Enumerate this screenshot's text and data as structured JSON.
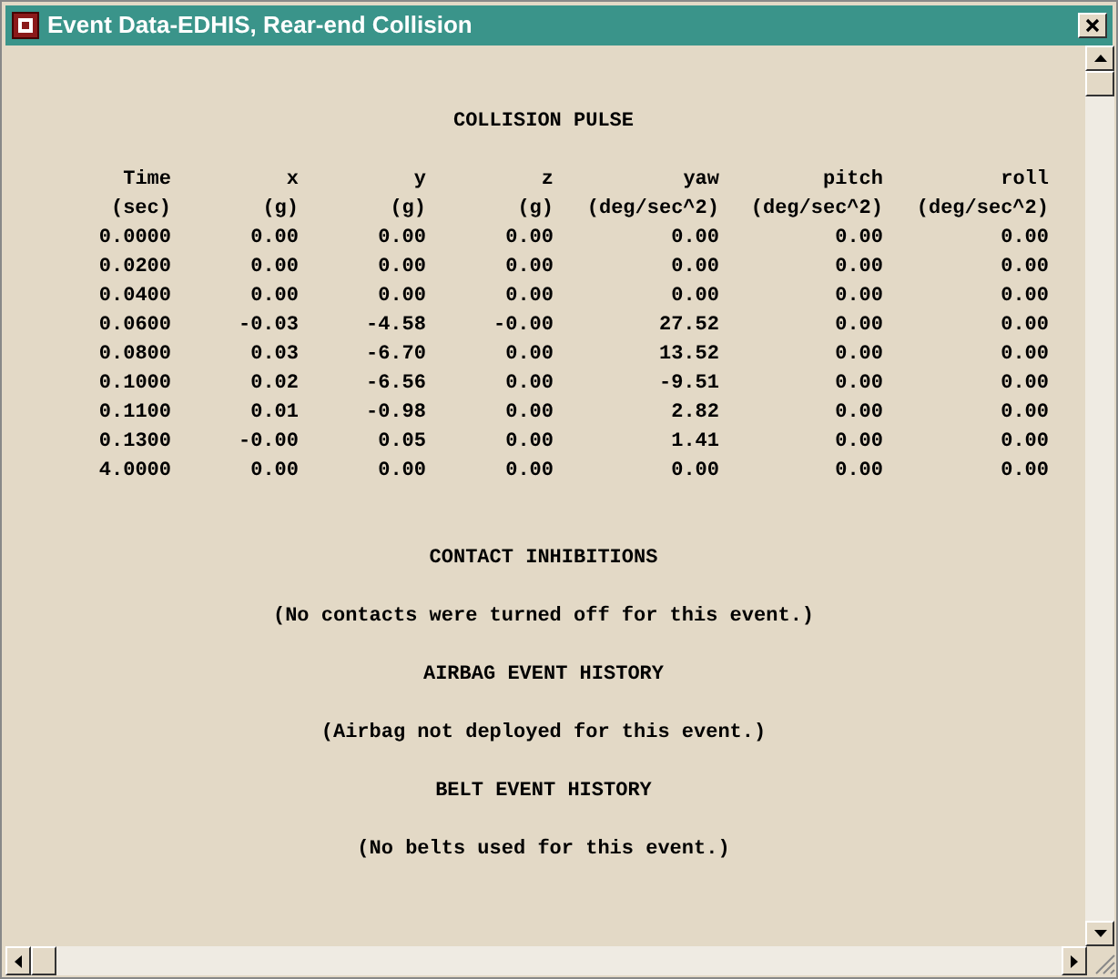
{
  "window": {
    "title": "Event Data-EDHIS, Rear-end Collision"
  },
  "pulse": {
    "heading": "COLLISION PULSE",
    "columns": [
      {
        "name": "Time",
        "unit": "(sec)"
      },
      {
        "name": "x",
        "unit": "(g)"
      },
      {
        "name": "y",
        "unit": "(g)"
      },
      {
        "name": "z",
        "unit": "(g)"
      },
      {
        "name": "yaw",
        "unit": "(deg/sec^2)"
      },
      {
        "name": "pitch",
        "unit": "(deg/sec^2)"
      },
      {
        "name": "roll",
        "unit": "(deg/sec^2)"
      }
    ],
    "rows": [
      [
        "0.0000",
        "0.00",
        "0.00",
        "0.00",
        "0.00",
        "0.00",
        "0.00"
      ],
      [
        "0.0200",
        "0.00",
        "0.00",
        "0.00",
        "0.00",
        "0.00",
        "0.00"
      ],
      [
        "0.0400",
        "0.00",
        "0.00",
        "0.00",
        "0.00",
        "0.00",
        "0.00"
      ],
      [
        "0.0600",
        "-0.03",
        "-4.58",
        "-0.00",
        "27.52",
        "0.00",
        "0.00"
      ],
      [
        "0.0800",
        "0.03",
        "-6.70",
        "0.00",
        "13.52",
        "0.00",
        "0.00"
      ],
      [
        "0.1000",
        "0.02",
        "-6.56",
        "0.00",
        "-9.51",
        "0.00",
        "0.00"
      ],
      [
        "0.1100",
        "0.01",
        "-0.98",
        "0.00",
        "2.82",
        "0.00",
        "0.00"
      ],
      [
        "0.1300",
        "-0.00",
        "0.05",
        "0.00",
        "1.41",
        "0.00",
        "0.00"
      ],
      [
        "4.0000",
        "0.00",
        "0.00",
        "0.00",
        "0.00",
        "0.00",
        "0.00"
      ]
    ]
  },
  "sections": [
    {
      "heading": "CONTACT INHIBITIONS",
      "message": "(No contacts were turned off for this event.)"
    },
    {
      "heading": "AIRBAG EVENT HISTORY",
      "message": "(Airbag not deployed for this event.)"
    },
    {
      "heading": "BELT EVENT HISTORY",
      "message": "(No belts used for this event.)"
    }
  ]
}
